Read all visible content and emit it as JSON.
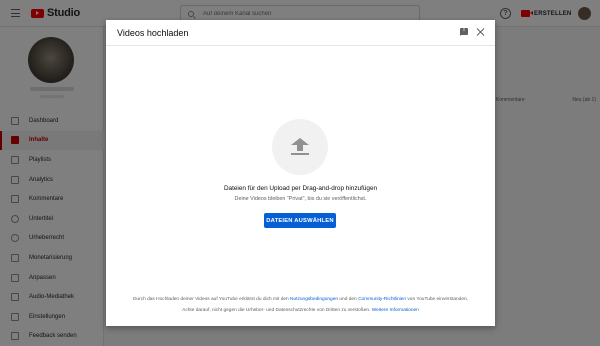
{
  "app": {
    "logo_text": "Studio",
    "search_placeholder": "Auf deinem Kanal suchen",
    "help_symbol": "?",
    "create_label": "ERSTELLEN"
  },
  "sidebar": {
    "items": [
      {
        "label": "Dashboard",
        "icon": "dashboard-icon",
        "active": false
      },
      {
        "label": "Inhalte",
        "icon": "content-icon",
        "active": true
      },
      {
        "label": "Playlists",
        "icon": "playlist-icon",
        "active": false
      },
      {
        "label": "Analytics",
        "icon": "analytics-icon",
        "active": false
      },
      {
        "label": "Kommentare",
        "icon": "comments-icon",
        "active": false
      },
      {
        "label": "Untertitel",
        "icon": "subtitles-icon",
        "active": false
      },
      {
        "label": "Urheberrecht",
        "icon": "copyright-icon",
        "active": false
      },
      {
        "label": "Monetarisierung",
        "icon": "monetization-icon",
        "active": false
      },
      {
        "label": "Anpassen",
        "icon": "customize-icon",
        "active": false
      },
      {
        "label": "Audio-Mediathek",
        "icon": "audio-library-icon",
        "active": false
      },
      {
        "label": "Einstellungen",
        "icon": "settings-icon",
        "active": false
      },
      {
        "label": "Feedback senden",
        "icon": "feedback-icon",
        "active": false
      }
    ]
  },
  "content": {
    "tab_comments": "Kommentare",
    "tab_sort": "Neu (ab 1)"
  },
  "dialog": {
    "title": "Videos hochladen",
    "drop_text": "Dateien für den Upload per Drag-and-drop hinzufügen",
    "private_text": "Deine Videos bleiben \"Privat\", bis du sie veröffentlichst.",
    "select_button": "DATEIEN AUSWÄHLEN",
    "footer_1_pre": "Durch das Hochladen deiner Videos auf YouTube erklärst du dich mit den ",
    "footer_1_link1": "Nutzungsbedingungen",
    "footer_1_mid": " und den ",
    "footer_1_link2": "Community-Richtlinien",
    "footer_1_post": " von YouTube einverstanden.",
    "footer_2_pre": "Achte darauf, nicht gegen die Urheber- und Datenschutzrechte von Dritten zu verstoßen. ",
    "footer_2_link": "Weitere Informationen"
  },
  "colors": {
    "accent_blue": "#065fd4",
    "brand_red": "#ff0000",
    "active_red": "#cc0000"
  }
}
